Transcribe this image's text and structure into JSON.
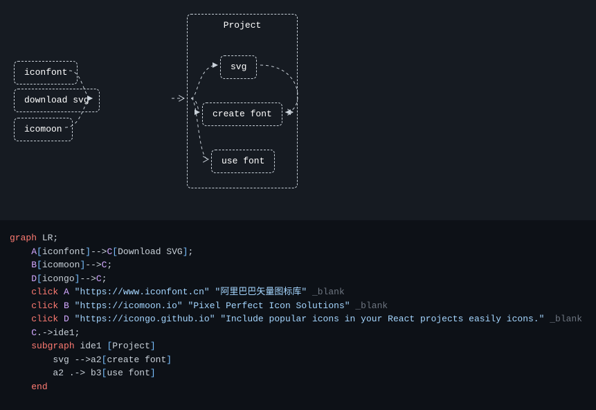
{
  "diagram": {
    "subgraph_title": "Project",
    "nodes": {
      "iconfont": "iconfont",
      "icomoon": "icomoon",
      "download_svg": "download svg",
      "svg": "svg",
      "create_font": "create font",
      "use_font": "use font"
    }
  },
  "code": {
    "l0": {
      "kw": "graph",
      "rest": " LR;"
    },
    "l1": {
      "id": "A",
      "br_open": "[",
      "name": "iconfont",
      "br_close": "]",
      "arrow": "-->",
      "id2": "C",
      "br2_open": "[",
      "name2": "Download SVG",
      "br2_close": "]",
      "semi": ";"
    },
    "l2": {
      "id": "B",
      "br_open": "[",
      "name": "icomoon",
      "br_close": "]",
      "arrow": "-->",
      "id2": "C",
      "semi": ";"
    },
    "l3": {
      "id": "D",
      "br_open": "[",
      "name": "icongo",
      "br_close": "]",
      "arrow": "-->",
      "id2": "C",
      "semi": ";"
    },
    "l4": {
      "kw": "click",
      "id": "A",
      "url": "\"https://www.iconfont.cn\"",
      "title": "\"阿里巴巴矢量图标库\"",
      "tgt": "_blank"
    },
    "l5": {
      "kw": "click",
      "id": "B",
      "url": "\"https://icomoon.io\"",
      "title": "\"Pixel Perfect Icon Solutions\"",
      "tgt": "_blank"
    },
    "l6": {
      "kw": "click",
      "id": "D",
      "url": "\"https://icongo.github.io\"",
      "title": "\"Include popular icons in your React projects easily icons.\"",
      "tgt": "_blank"
    },
    "l7": {
      "id": "C",
      "arrow": ".->",
      "id2": "ide1",
      "semi": ";"
    },
    "l8": {
      "kw": "subgraph",
      "id": "ide1",
      "br_open": " [",
      "name": "Project",
      "br_close": "]"
    },
    "l9": {
      "id": "svg",
      "arrow": " -->",
      "id2": "a2",
      "br_open": "[",
      "name": "create font",
      "br_close": "]"
    },
    "l10": {
      "id": "a2",
      "arrow": " .->",
      "id2": " b3",
      "br_open": "[",
      "name": "use font",
      "br_close": "]"
    },
    "l11": {
      "kw": "end"
    }
  }
}
